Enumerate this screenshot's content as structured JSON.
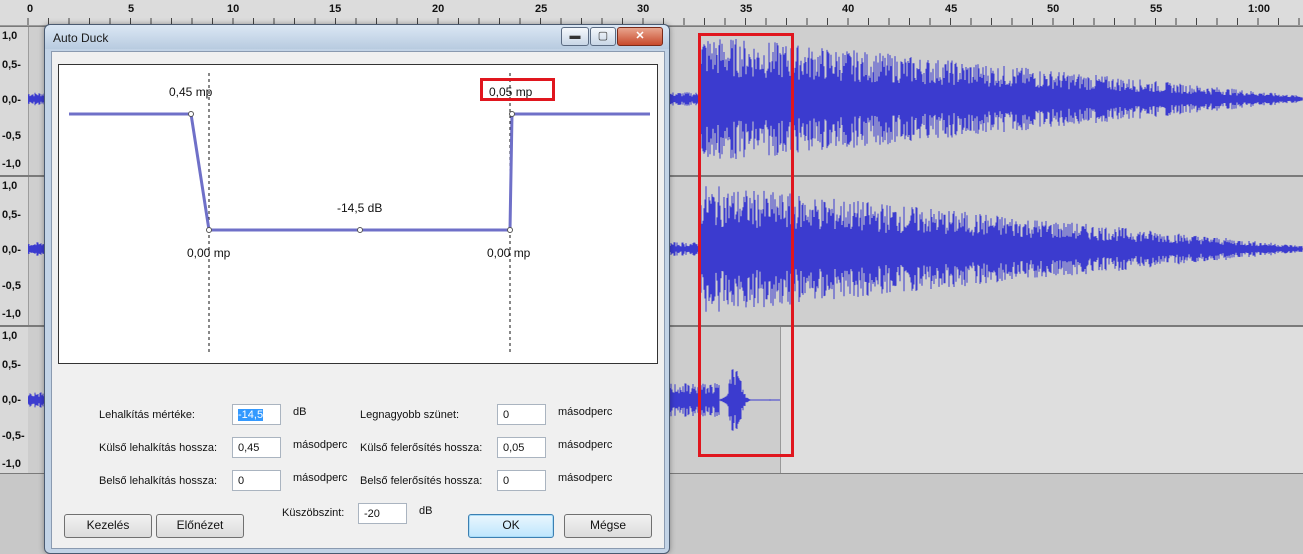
{
  "ruler": {
    "ticks": [
      "0",
      "5",
      "10",
      "15",
      "20",
      "25",
      "30",
      "35",
      "40",
      "45",
      "50",
      "55",
      "1:00"
    ]
  },
  "tracks": [
    {
      "labels": [
        "1,0",
        "0,5-",
        "0,0-",
        "-0,5",
        "-1,0"
      ]
    },
    {
      "labels": [
        "1,0",
        "0,5-",
        "0,0-",
        "-0,5",
        "-1,0"
      ]
    },
    {
      "labels": [
        "1,0",
        "0,5-",
        "0,0-",
        "-0,5-",
        "-1,0"
      ]
    }
  ],
  "dialog": {
    "title": "Auto Duck",
    "window_buttons": {
      "minimize": "▬",
      "maximize": "▢",
      "close": "✕"
    },
    "graph": {
      "outer_fade_down": "0,45 mp",
      "outer_fade_up": "0,05 mp",
      "duck_amount": "-14,5 dB",
      "inner_fade_down": "0,00 mp",
      "inner_fade_up": "0,00 mp"
    },
    "fields": {
      "duck_amount": {
        "label": "Lehalkítás mértéke:",
        "value": "-14,5",
        "unit": "dB"
      },
      "max_pause": {
        "label": "Legnagyobb szünet:",
        "value": "0",
        "unit": "másodperc"
      },
      "outer_fade_down": {
        "label": "Külső lehalkítás hossza:",
        "value": "0,45",
        "unit": "másodperc"
      },
      "outer_fade_up": {
        "label": "Külső felerősítés hossza:",
        "value": "0,05",
        "unit": "másodperc"
      },
      "inner_fade_down": {
        "label": "Belső lehalkítás hossza:",
        "value": "0",
        "unit": "másodperc"
      },
      "inner_fade_up": {
        "label": "Belső felerősítés hossza:",
        "value": "0",
        "unit": "másodperc"
      },
      "threshold": {
        "label": "Küszöbszint:",
        "value": "-20",
        "unit": "dB"
      }
    },
    "buttons": {
      "manage": "Kezelés",
      "preview": "Előnézet",
      "ok": "OK",
      "cancel": "Mégse"
    }
  },
  "colors": {
    "waveform": "#3b3bcf",
    "envelope": "#6f70c8",
    "highlight": "#e0161e"
  }
}
